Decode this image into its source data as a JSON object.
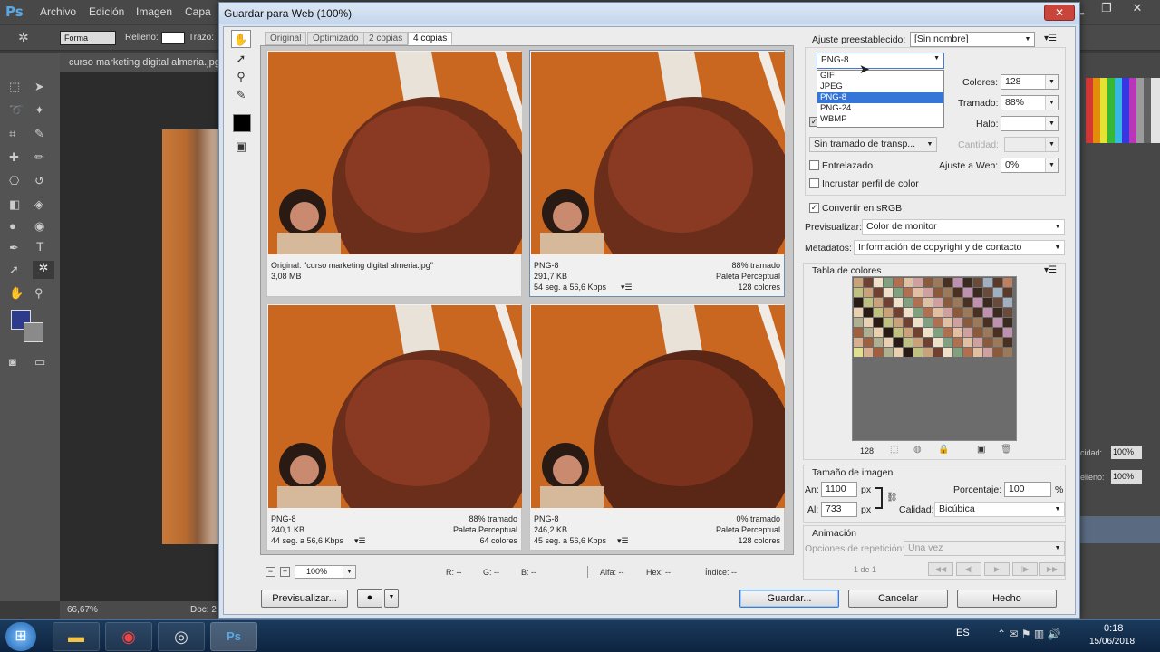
{
  "ps": {
    "logo": "Ps",
    "menu": [
      "Archivo",
      "Edición",
      "Imagen",
      "Capa"
    ],
    "options": {
      "shape_label": "Forma",
      "fill_label": "Relleno:",
      "stroke_label": "Trazo:"
    },
    "doc_tab": "curso marketing digital almeria.jpg",
    "status_zoom": "66,67%",
    "status_doc": "Doc: 2",
    "right_labels": {
      "opacity": "cidad:",
      "opacity_val": "100%",
      "fill": "elleno:",
      "fill_val": "100%"
    },
    "colors": {
      "fg": "#2e3a8c",
      "bg": "#8a8a8a"
    }
  },
  "dialog": {
    "title": "Guardar para Web (100%)",
    "tabs": [
      "Original",
      "Optimizado",
      "2 copias",
      "4 copias"
    ],
    "panes": [
      {
        "left": [
          "Original: \"curso marketing digital almeria.jpg\"",
          "3,08 MB",
          ""
        ],
        "right": [
          "",
          "",
          ""
        ]
      },
      {
        "left": [
          "PNG-8",
          "291,7 KB",
          "54 seg. a 56,6 Kbps"
        ],
        "right": [
          "88% tramado",
          "Paleta Perceptual",
          "128 colores"
        ]
      },
      {
        "left": [
          "PNG-8",
          "240,1 KB",
          "44 seg. a 56,6 Kbps"
        ],
        "right": [
          "88% tramado",
          "Paleta Perceptual",
          "64 colores"
        ]
      },
      {
        "left": [
          "PNG-8",
          "246,2 KB",
          "45 seg. a 56,6 Kbps"
        ],
        "right": [
          "0% tramado",
          "Paleta Perceptual",
          "128 colores"
        ]
      }
    ],
    "bottombar": {
      "zoom": "100%",
      "r": "R: --",
      "g": "G: --",
      "b": "B: --",
      "alpha": "Alfa: --",
      "hex": "Hex: --",
      "index": "Índice: --"
    },
    "preset_label": "Ajuste preestablecido:",
    "preset_value": "[Sin nombre]",
    "format_value": "PNG-8",
    "format_options": [
      "GIF",
      "JPEG",
      "PNG-8",
      "PNG-24",
      "WBMP"
    ],
    "colors_label": "Colores:",
    "colors_value": "128",
    "dither_label": "Tramado:",
    "dither_value": "88%",
    "matte_label": "Halo:",
    "matte_value": "",
    "transp_dither": "Sin tramado de transp...",
    "amount_label": "Cantidad:",
    "interlaced": "Entrelazado",
    "websnap_label": "Ajuste a Web:",
    "websnap_value": "0%",
    "embed_profile": "Incrustar perfil de color",
    "convert_srgb": "Convertir en sRGB",
    "preview_label": "Previsualizar:",
    "preview_value": "Color de monitor",
    "metadata_label": "Metadatos:",
    "metadata_value": "Información de copyright y de contacto",
    "color_table_label": "Tabla de colores",
    "color_count": "128",
    "image_size_label": "Tamaño de imagen",
    "width_label": "An:",
    "width_value": "1100",
    "height_label": "Al:",
    "height_value": "733",
    "px": "px",
    "percent_label": "Porcentaje:",
    "percent_value": "100",
    "percent_unit": "%",
    "quality_label": "Calidad:",
    "quality_value": "Bicúbica",
    "animation_label": "Animación",
    "loop_label": "Opciones de repetición:",
    "loop_value": "Una vez",
    "frame_counter": "1 de 1",
    "buttons": {
      "preview": "Previsualizar...",
      "save": "Guardar...",
      "cancel": "Cancelar",
      "done": "Hecho"
    }
  },
  "taskbar": {
    "lang": "ES",
    "time": "0:18",
    "date": "15/06/2018"
  }
}
